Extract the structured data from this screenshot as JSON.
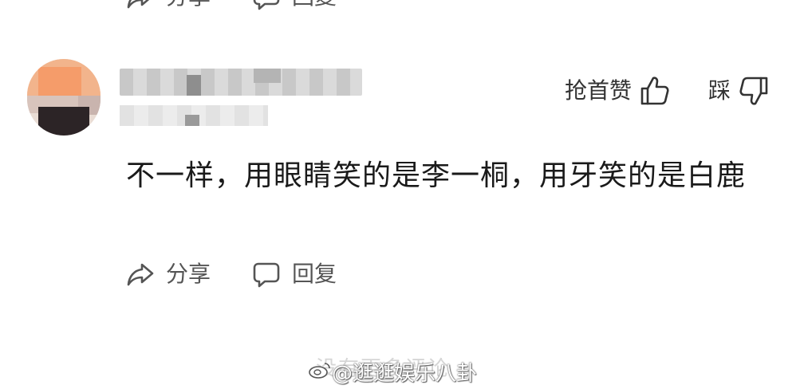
{
  "previous_comment": {
    "share_label": "分享",
    "reply_label": "回复"
  },
  "comment": {
    "avatar": "avatar-pixelated",
    "username": "",
    "meta": "",
    "like_label": "抢首赞",
    "dislike_label": "踩",
    "text": "不一样，用眼睛笑的是李一桐，用牙笑的是白鹿",
    "share_label": "分享",
    "reply_label": "回复"
  },
  "watermark": {
    "ghost_text": "没有更多评论",
    "text": "@逛逛娱乐八卦"
  },
  "icons": {
    "share": "share-icon",
    "reply": "reply-icon",
    "like": "thumbs-up-icon",
    "dislike": "thumbs-down-icon",
    "weibo": "weibo-logo-icon"
  },
  "colors": {
    "text_primary": "#1a1a1a",
    "text_secondary": "#555555",
    "icon_stroke": "#555555",
    "background": "#ffffff"
  }
}
